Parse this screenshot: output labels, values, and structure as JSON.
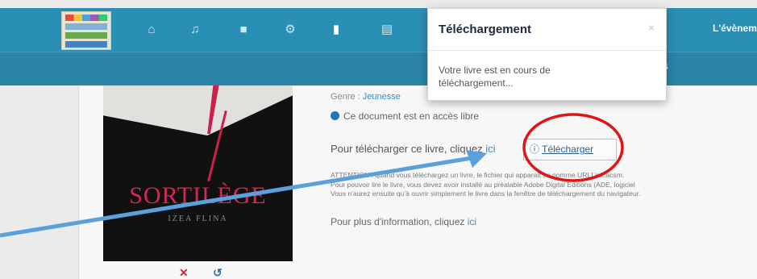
{
  "nav": {
    "icons": [
      "home-icon",
      "music-icon",
      "video-icon",
      "gears-icon",
      "book-icon",
      "newspaper-icon"
    ],
    "right_text": "L'évènem",
    "subnav_text": "S"
  },
  "book": {
    "cover_title": "SORTILÈGE",
    "cover_author": "IZEA FLINA",
    "genre_label": "Genre :",
    "genre_value": "Jeunesse",
    "free_access": "Ce document est en accès libre",
    "download_prompt": "Pour télécharger ce livre, cliquez",
    "download_prompt_link": "ici",
    "download_button": "Télécharger",
    "attention_lines": [
      "ATTENTION : quand vous téléchargez un livre, le fichier qui apparaît se nomme URLLink.acsm.",
      "Pour pouvoir lire le livre, vous devez avoir installé au préalable Adobe Digital Editions (ADE, logiciel",
      "Vous n'aurez ensuite qu'à ouvrir simplement le livre dans la fenêtre de téléchargement du navigateur."
    ],
    "more_info": "Pour plus d'information, cliquez",
    "more_info_link": "ici"
  },
  "modal": {
    "title": "Téléchargement",
    "close": "×",
    "body": "Votre livre est en cours de téléchargement..."
  },
  "colors": {
    "nav_bg": "#2a8fb4",
    "annotation_circle": "#e01515",
    "annotation_arrow": "#5aa0dd"
  }
}
